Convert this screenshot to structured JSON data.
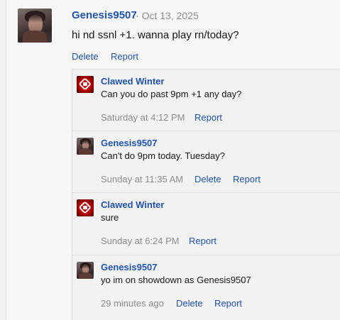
{
  "post": {
    "author": "Genesis9507",
    "date": "Oct 13, 2025",
    "text": "hi nd ssnl +1. wanna play rn/today?",
    "actions": {
      "delete": "Delete",
      "report": "Report"
    }
  },
  "replies": [
    {
      "author": "Clawed Winter",
      "text": "Can you do past 9pm +1 any day?",
      "time": "Saturday at 4:12 PM",
      "report": "Report",
      "avatar_icon": "falcon-logo-icon"
    },
    {
      "author": "Genesis9507",
      "text": "Can't do 9pm today. Tuesday?",
      "time": "Sunday at 11:35 AM",
      "delete": "Delete",
      "report": "Report",
      "avatar_icon": "user-portrait-icon"
    },
    {
      "author": "Clawed Winter",
      "text": "sure",
      "time": "Sunday at 6:24 PM",
      "report": "Report",
      "avatar_icon": "falcon-logo-icon"
    },
    {
      "author": "Genesis9507",
      "text": "yo im on showdown as Genesis9507",
      "time": "29 minutes ago",
      "delete": "Delete",
      "report": "Report",
      "avatar_icon": "user-portrait-icon"
    }
  ],
  "colors": {
    "link": "#1e54b0",
    "muted": "#8c8c8c",
    "text": "#141414"
  }
}
